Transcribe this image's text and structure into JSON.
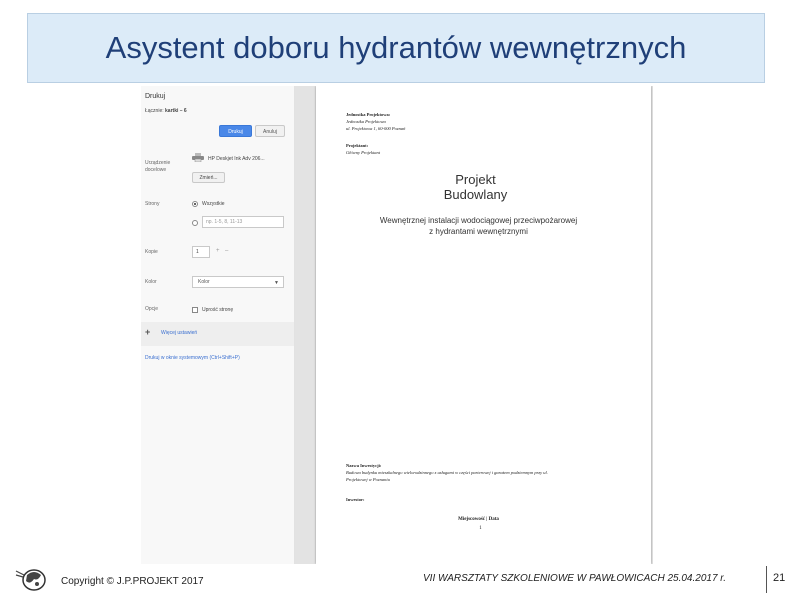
{
  "slide": {
    "title": "Asystent doboru hydrantów wewnętrznych",
    "footer": {
      "copyright": "Copyright © J.P.PROJEKT 2017",
      "workshop": "VII WARSZTATY SZKOLENIOWE W PAWŁOWICACH  25.04.2017 r.",
      "page_number": "21"
    }
  },
  "print_dialog": {
    "title": "Drukuj",
    "summary_prefix": "Łącznie:",
    "summary_value": "kartki – 6",
    "print_button": "Drukuj",
    "cancel_button": "Anuluj",
    "destination_label": "Urządzenie docelowe",
    "printer_name": "HP Deskjet Ink Adv 206...",
    "change_button": "Zmień...",
    "pages_label": "Strony",
    "pages_all": "Wszystkie",
    "pages_range_placeholder": "np. 1-5, 8, 11-13",
    "copies_label": "Kopie",
    "copies_value": "1",
    "copies_plus": "+",
    "copies_minus": "–",
    "color_label": "Kolor",
    "color_value": "Kolor",
    "options_label": "Opcje",
    "simplify_label": "Uprość stronę",
    "more_settings": "Więcej ustawień",
    "system_dialog_link": "Drukuj w oknie systemowym (Ctrl+Shift+P)"
  },
  "document_preview": {
    "unit_label": "Jednostka Projektowa:",
    "unit_name": "Jednostka Projektowa",
    "unit_address": "ul. Projektowa 1, 60-000 Poznań",
    "designer_label": "Projektant:",
    "designer_name": "Główny Projektant",
    "title_line1": "Projekt",
    "title_line2": "Budowlany",
    "desc_line1": "Wewnętrznej instalacji wodociągowej przeciwpożarowej",
    "desc_line2": "z hydrantami wewnętrznymi",
    "investment_label": "Nazwa Inwestycji:",
    "investment_line1": "Budowa budynku mieszkalnego wielorodzinnego z usługami w części parterowej i garażem podziemnym przy ul.",
    "investment_line2": "Projektowej w Poznaniu",
    "investor_label": "Inwestor:",
    "place_date": "Miejscowość | Data",
    "page_marker": "1"
  },
  "icons": {
    "printer": "printer-icon",
    "plus": "plus-icon",
    "caret": "chevron-down-icon",
    "logo": "company-logo"
  }
}
